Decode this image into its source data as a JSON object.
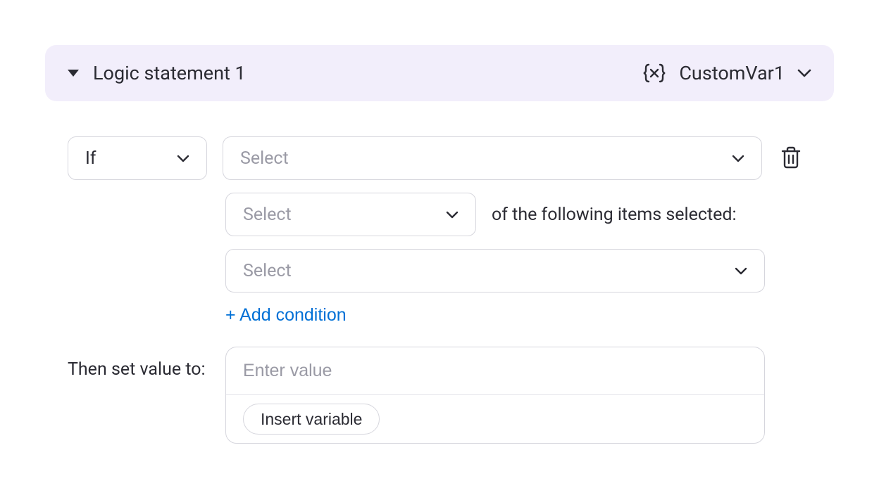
{
  "header": {
    "title": "Logic statement 1",
    "variable": "CustomVar1"
  },
  "condition": {
    "if_label": "If",
    "select1_placeholder": "Select",
    "select2_placeholder": "Select",
    "items_text": "of the following items selected:",
    "select3_placeholder": "Select",
    "add_condition_label": "+ Add condition"
  },
  "then": {
    "label": "Then set value to:",
    "value_placeholder": "Enter value",
    "insert_var_label": "Insert variable"
  }
}
